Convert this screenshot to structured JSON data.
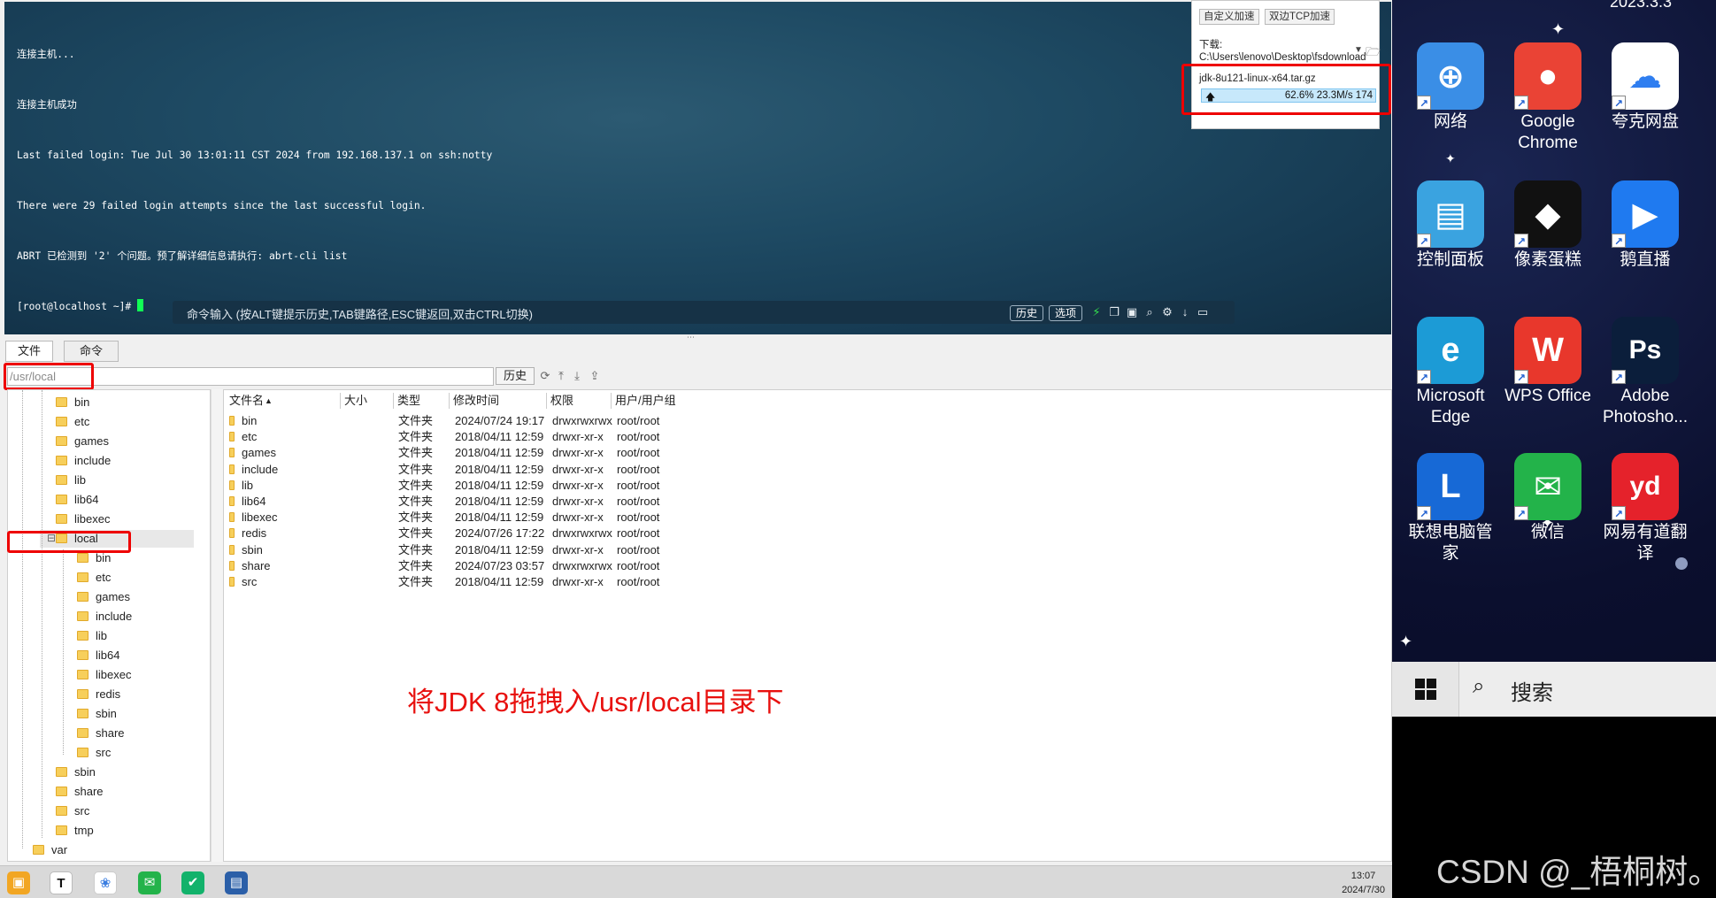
{
  "terminal": {
    "lines": [
      "连接主机...",
      "连接主机成功",
      "Last failed login: Tue Jul 30 13:01:11 CST 2024 from 192.168.137.1 on ssh:notty",
      "There were 29 failed login attempts since the last successful login.",
      "ABRT 已检测到 '2' 个问题。预了解详细信息请执行: abrt-cli list",
      "[root@localhost ~]# "
    ]
  },
  "command_bar": {
    "hint": "命令输入 (按ALT键提示历史,TAB键路径,ESC键返回,双击CTRL切换)",
    "history_button": "历史",
    "options_button": "选项",
    "icons": [
      "lightning-icon",
      "copy-icon",
      "paste-icon",
      "search-icon",
      "gear-icon",
      "arrow-down-icon",
      "window-icon"
    ]
  },
  "download_panel": {
    "btn_custom": "自定义加速",
    "btn_tcp": "双边TCP加速",
    "label": "下载: C:\\Users\\lenovo\\Desktop\\fsdownload",
    "file": "jdk-8u121-linux-x64.tar.gz",
    "progress_percent": 62.6,
    "stats": "62.6% 23.3M/s 174"
  },
  "tabs": [
    "文件",
    "命令"
  ],
  "path_bar": {
    "value": "/usr/local",
    "history_button": "历史"
  },
  "tree": [
    {
      "label": "bin",
      "level": 1
    },
    {
      "label": "etc",
      "level": 1
    },
    {
      "label": "games",
      "level": 1
    },
    {
      "label": "include",
      "level": 1
    },
    {
      "label": "lib",
      "level": 1
    },
    {
      "label": "lib64",
      "level": 1
    },
    {
      "label": "libexec",
      "level": 1
    },
    {
      "label": "local",
      "level": 1,
      "expanded": true,
      "selected": true
    },
    {
      "label": "bin",
      "level": 2
    },
    {
      "label": "etc",
      "level": 2
    },
    {
      "label": "games",
      "level": 2
    },
    {
      "label": "include",
      "level": 2
    },
    {
      "label": "lib",
      "level": 2
    },
    {
      "label": "lib64",
      "level": 2
    },
    {
      "label": "libexec",
      "level": 2
    },
    {
      "label": "redis",
      "level": 2
    },
    {
      "label": "sbin",
      "level": 2
    },
    {
      "label": "share",
      "level": 2
    },
    {
      "label": "src",
      "level": 2
    },
    {
      "label": "sbin",
      "level": 1
    },
    {
      "label": "share",
      "level": 1
    },
    {
      "label": "src",
      "level": 1
    },
    {
      "label": "tmp",
      "level": 1
    },
    {
      "label": "var",
      "level": 0
    }
  ],
  "file_table": {
    "headers": [
      "文件名",
      "大小",
      "类型",
      "修改时间",
      "权限",
      "用户/用户组"
    ],
    "rows": [
      [
        "bin",
        "",
        "文件夹",
        "2024/07/24 19:17",
        "drwxrwxrwx",
        "root/root"
      ],
      [
        "etc",
        "",
        "文件夹",
        "2018/04/11 12:59",
        "drwxr-xr-x",
        "root/root"
      ],
      [
        "games",
        "",
        "文件夹",
        "2018/04/11 12:59",
        "drwxr-xr-x",
        "root/root"
      ],
      [
        "include",
        "",
        "文件夹",
        "2018/04/11 12:59",
        "drwxr-xr-x",
        "root/root"
      ],
      [
        "lib",
        "",
        "文件夹",
        "2018/04/11 12:59",
        "drwxr-xr-x",
        "root/root"
      ],
      [
        "lib64",
        "",
        "文件夹",
        "2018/04/11 12:59",
        "drwxr-xr-x",
        "root/root"
      ],
      [
        "libexec",
        "",
        "文件夹",
        "2018/04/11 12:59",
        "drwxr-xr-x",
        "root/root"
      ],
      [
        "redis",
        "",
        "文件夹",
        "2024/07/26 17:22",
        "drwxrwxrwx",
        "root/root"
      ],
      [
        "sbin",
        "",
        "文件夹",
        "2018/04/11 12:59",
        "drwxr-xr-x",
        "root/root"
      ],
      [
        "share",
        "",
        "文件夹",
        "2024/07/23 03:57",
        "drwxrwxrwx",
        "root/root"
      ],
      [
        "src",
        "",
        "文件夹",
        "2018/04/11 12:59",
        "drwxr-xr-x",
        "root/root"
      ]
    ]
  },
  "annotation": "将JDK 8拖拽入/usr/local目录下",
  "taskbar": {
    "icons": [
      "finalshell-icon",
      "typora-icon",
      "app-icon",
      "wechat-icon",
      "message-icon",
      "remote-icon"
    ],
    "time": "13:07",
    "date": "2024/7/30"
  },
  "desktop": {
    "clock": "2023.3.3",
    "icons": [
      {
        "name": "network-icon",
        "label": "网络",
        "color": "#3a8ee6",
        "glyph": "⊕"
      },
      {
        "name": "chrome-icon",
        "label": "Google Chrome",
        "color": "#ea4335",
        "glyph": "●"
      },
      {
        "name": "quark-drive-icon",
        "label": "夸克网盘",
        "color": "#ffffff",
        "glyph": "☁"
      },
      {
        "name": "control-panel-icon",
        "label": "控制面板",
        "color": "#3aa3e0",
        "glyph": "▤"
      },
      {
        "name": "pixel-cake-icon",
        "label": "像素蛋糕",
        "color": "#111111",
        "glyph": "◆"
      },
      {
        "name": "live-icon",
        "label": "鹅直播",
        "color": "#1f7af0",
        "glyph": "▶"
      },
      {
        "name": "edge-icon",
        "label": "Microsoft Edge",
        "color": "#1c9bd6",
        "glyph": "e"
      },
      {
        "name": "wps-icon",
        "label": "WPS Office",
        "color": "#e8372c",
        "glyph": "W"
      },
      {
        "name": "photoshop-icon",
        "label": "Adobe Photosho...",
        "color": "#0b1e3b",
        "glyph": "Ps"
      },
      {
        "name": "lenovo-icon",
        "label": "联想电脑管家",
        "color": "#1769d6",
        "glyph": "L"
      },
      {
        "name": "wechat-icon",
        "label": "微信",
        "color": "#23b34a",
        "glyph": "✉"
      },
      {
        "name": "youdao-icon",
        "label": "网易有道翻译",
        "color": "#e5222b",
        "glyph": "yd"
      }
    ],
    "search_label": "搜索"
  },
  "watermark": "CSDN @_梧桐树。"
}
